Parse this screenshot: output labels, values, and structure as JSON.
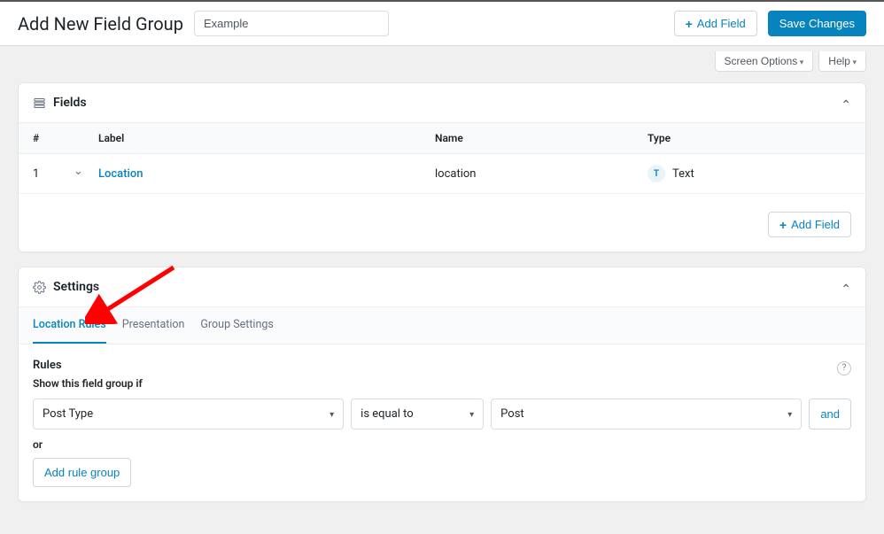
{
  "header": {
    "page_title": "Add New Field Group",
    "title_input_value": "Example",
    "add_field_label": "Add Field",
    "save_label": "Save Changes"
  },
  "screen_options": {
    "screen_options_label": "Screen Options",
    "help_label": "Help"
  },
  "fields_panel": {
    "title": "Fields",
    "columns": {
      "num": "#",
      "label": "Label",
      "name": "Name",
      "type": "Type"
    },
    "rows": [
      {
        "num": "1",
        "label": "Location",
        "name": "location",
        "type_badge": "T",
        "type_label": "Text"
      }
    ],
    "footer_add_field": "Add Field"
  },
  "settings_panel": {
    "title": "Settings",
    "tabs": [
      {
        "label": "Location Rules",
        "active": true
      },
      {
        "label": "Presentation",
        "active": false
      },
      {
        "label": "Group Settings",
        "active": false
      }
    ],
    "rules": {
      "heading": "Rules",
      "sub": "Show this field group if",
      "row": {
        "param": "Post Type",
        "operator": "is equal to",
        "value": "Post",
        "and_label": "and"
      },
      "or_label": "or",
      "add_rule_group_label": "Add rule group"
    }
  },
  "annotation": {
    "arrow_color": "#ff0000"
  }
}
